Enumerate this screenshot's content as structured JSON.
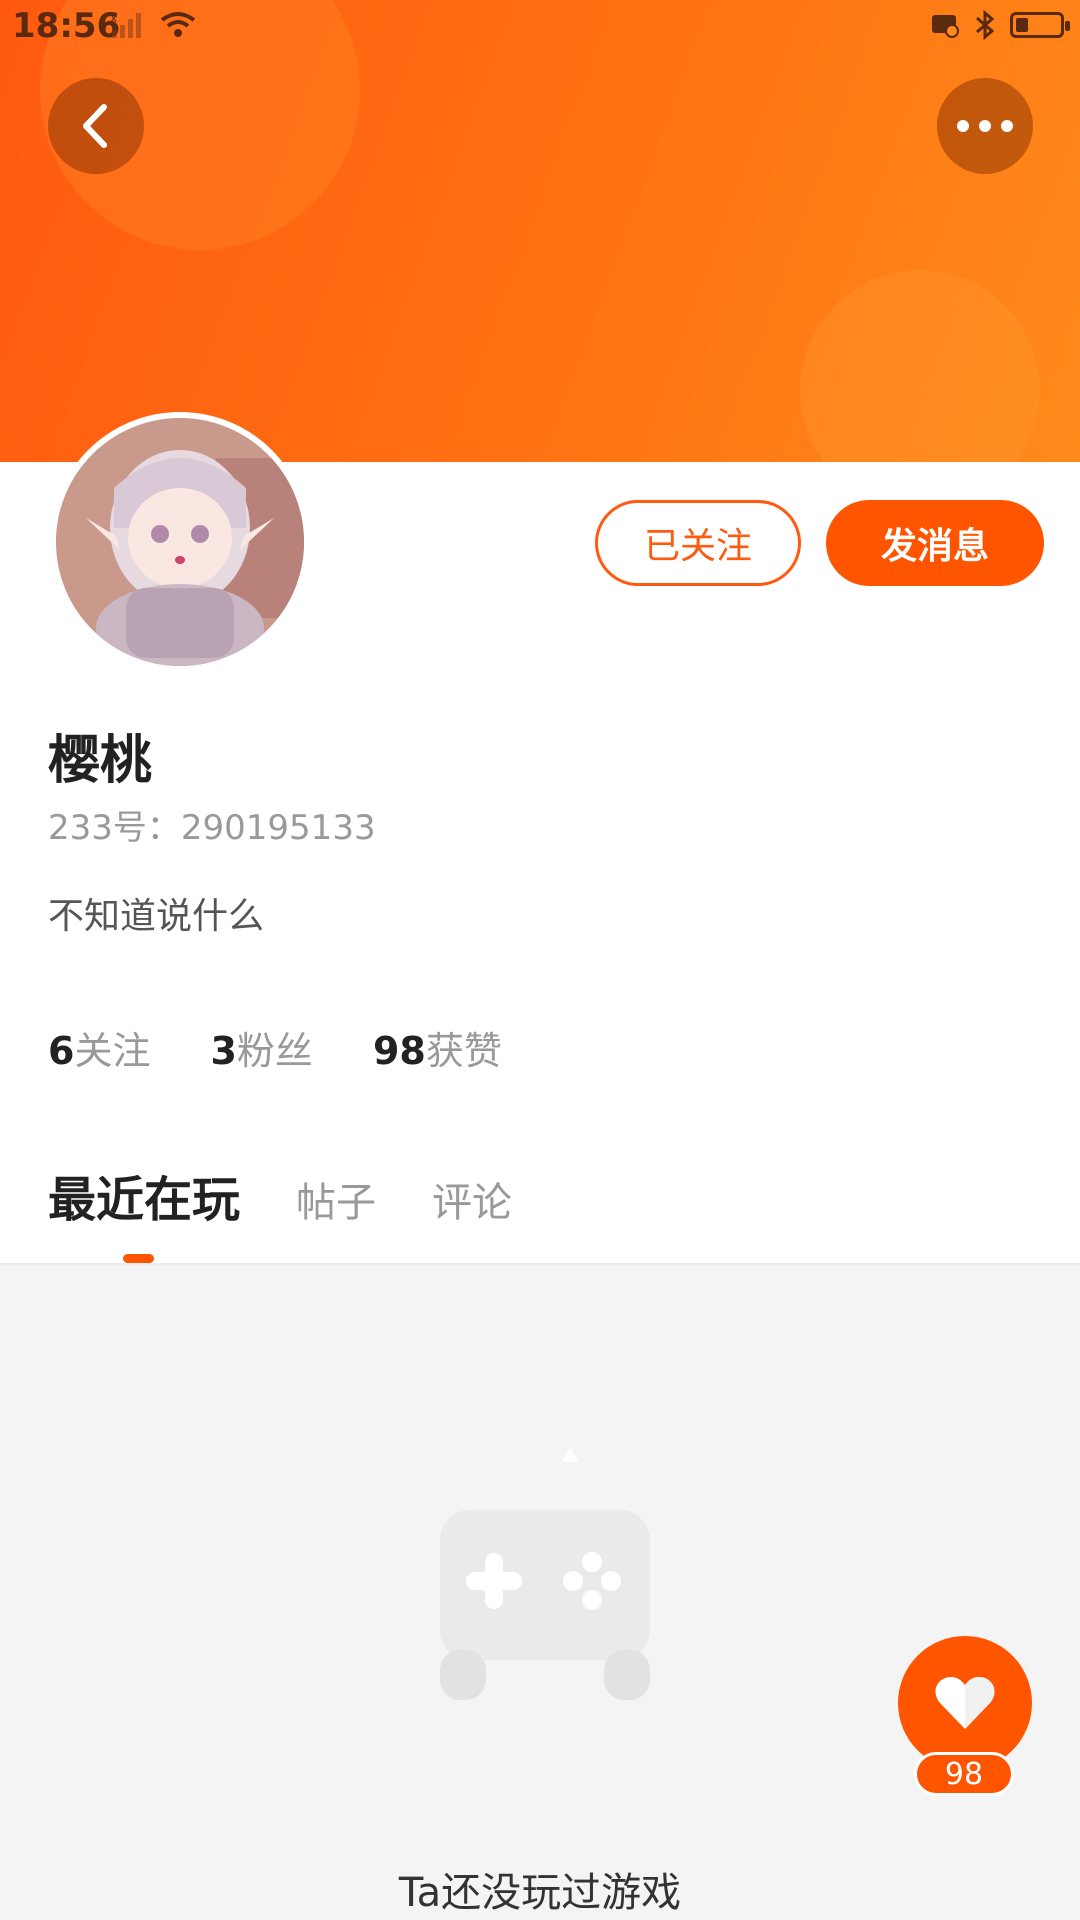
{
  "status_bar": {
    "time": "18:56",
    "signal_icons": [
      "no-signal-icon",
      "cellular-icon",
      "wifi-icon"
    ],
    "right_icons": [
      "cast-off-icon",
      "bluetooth-icon",
      "battery-icon"
    ]
  },
  "header": {
    "back_icon": "chevron-left-icon",
    "more_icon": "more-dots-icon",
    "banner_color": "#ff6d12"
  },
  "profile": {
    "name": "樱桃",
    "id_text": "233号：290195133",
    "bio": "不知道说什么",
    "follow_label": "已关注",
    "message_label": "发消息",
    "stats": [
      {
        "value": "6",
        "label": "关注"
      },
      {
        "value": "3",
        "label": "粉丝"
      },
      {
        "value": "98",
        "label": "获赞"
      }
    ]
  },
  "tabs": [
    {
      "label": "最近在玩",
      "active": true
    },
    {
      "label": "帖子",
      "active": false
    },
    {
      "label": "评论",
      "active": false
    }
  ],
  "empty_state": {
    "icon": "gamepad-icon",
    "text": "Ta还没玩过游戏"
  },
  "like_fab": {
    "icon": "heart-icon",
    "count": "98"
  },
  "colors": {
    "accent": "#ff5500",
    "text_primary": "#222222",
    "text_secondary": "#999999"
  }
}
